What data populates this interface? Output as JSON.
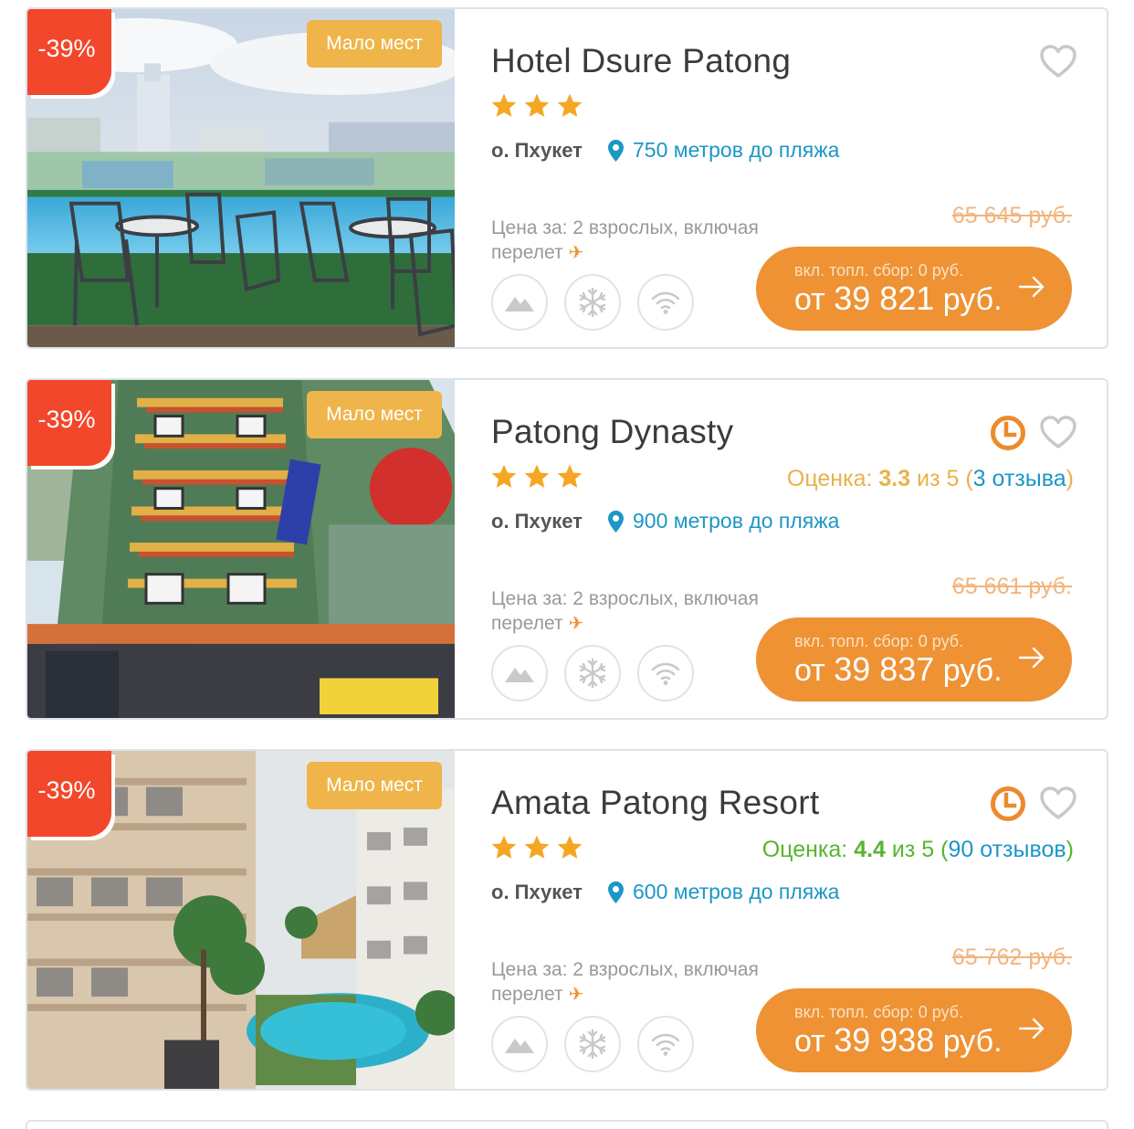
{
  "hotels": [
    {
      "discount": "-39%",
      "badge": "Мало мест",
      "name": "Hotel Dsure Patong",
      "island": "о. Пхукет",
      "distance": "750 метров до пляжа",
      "price_for": "Цена за: 2 взрослых, включая перелет",
      "old_price": "65 645 руб.",
      "fee": "вкл. топл. сбор: 0 руб.",
      "price_prefix": "от",
      "price_value": "39 821",
      "price_suffix": "руб.",
      "stars": 3
    },
    {
      "discount": "-39%",
      "badge": "Мало мест",
      "name": "Patong Dynasty",
      "rating_label": "Оценка:",
      "rating_value": "3.3",
      "rating_of": "из 5",
      "rating_reviews": "3 отзыва",
      "island": "о. Пхукет",
      "distance": "900 метров до пляжа",
      "price_for": "Цена за: 2 взрослых, включая перелет",
      "old_price": "65 661 руб.",
      "fee": "вкл. топл. сбор: 0 руб.",
      "price_prefix": "от",
      "price_value": "39 837",
      "price_suffix": "руб.",
      "stars": 3
    },
    {
      "discount": "-39%",
      "badge": "Мало мест",
      "name": "Amata Patong Resort",
      "rating_label": "Оценка:",
      "rating_value": "4.4",
      "rating_of": "из 5",
      "rating_reviews": "90 отзывов",
      "island": "о. Пхукет",
      "distance": "600 метров до пляжа",
      "price_for": "Цена за: 2 взрослых, включая перелет",
      "old_price": "65 762 руб.",
      "fee": "вкл. топл. сбор: 0 руб.",
      "price_prefix": "от",
      "price_value": "39 938",
      "price_suffix": "руб.",
      "stars": 3
    }
  ],
  "icons": {
    "favorite": "heart-icon",
    "timer": "clock-icon",
    "location": "map-pin-icon",
    "flight": "plane-icon",
    "amenities": [
      "mountain-icon",
      "snowflake-icon",
      "wifi-icon"
    ],
    "buy": "arrow-right-icon"
  },
  "colors": {
    "discount": "#f2472b",
    "badge": "#efb54a",
    "accent": "#ee9234",
    "link": "#1c97c6",
    "rating_mid": "#e9b14a",
    "rating_good": "#56b52f",
    "star": "#f5a623"
  }
}
